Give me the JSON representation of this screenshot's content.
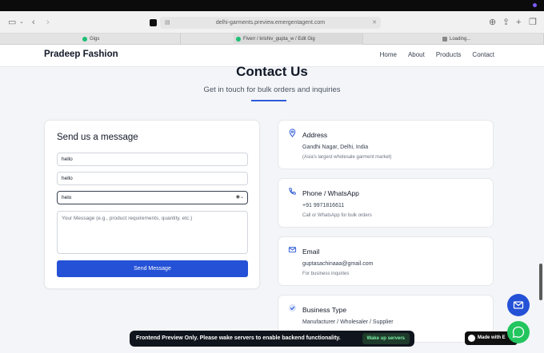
{
  "browser": {
    "url": "delhi-garments.preview.emergentagent.com",
    "tabs": [
      {
        "label": "Gigs"
      },
      {
        "label": "Fiverr / krishiv_gupta_w / Edit Gig"
      },
      {
        "label": "Loading..."
      }
    ]
  },
  "site": {
    "brand": "Pradeep Fashion",
    "nav": [
      "Home",
      "About",
      "Products",
      "Contact"
    ]
  },
  "hero": {
    "title": "Contact Us",
    "subtitle": "Get in touch for bulk orders and inquiries"
  },
  "form": {
    "title": "Send us a message",
    "field1": "hello",
    "field2": "hello",
    "field3": "helo",
    "message_placeholder": "Your Message (e.g., product requirements, quantity, etc.)",
    "submit": "Send Message"
  },
  "info": [
    {
      "title": "Address",
      "line1": "Gandhi Nagar, Delhi, India",
      "line2": "(Asia's largest wholesale garment market)"
    },
    {
      "title": "Phone / WhatsApp",
      "line1": "+91 9971816611",
      "line2": "Call or WhatsApp for bulk orders"
    },
    {
      "title": "Email",
      "line1": "guptasachinaaa@gmail.com",
      "line2": "For business inquiries"
    },
    {
      "title": "Business Type",
      "line1": "Manufacturer / Wholesaler / Supplier"
    }
  ],
  "banner": {
    "text": "Frontend Preview Only. Please wake servers to enable backend functionality.",
    "button": "Wake up servers"
  },
  "badge": {
    "text": "Made with E"
  },
  "colors": {
    "primary": "#2451d6",
    "whatsapp": "#22c55e"
  }
}
